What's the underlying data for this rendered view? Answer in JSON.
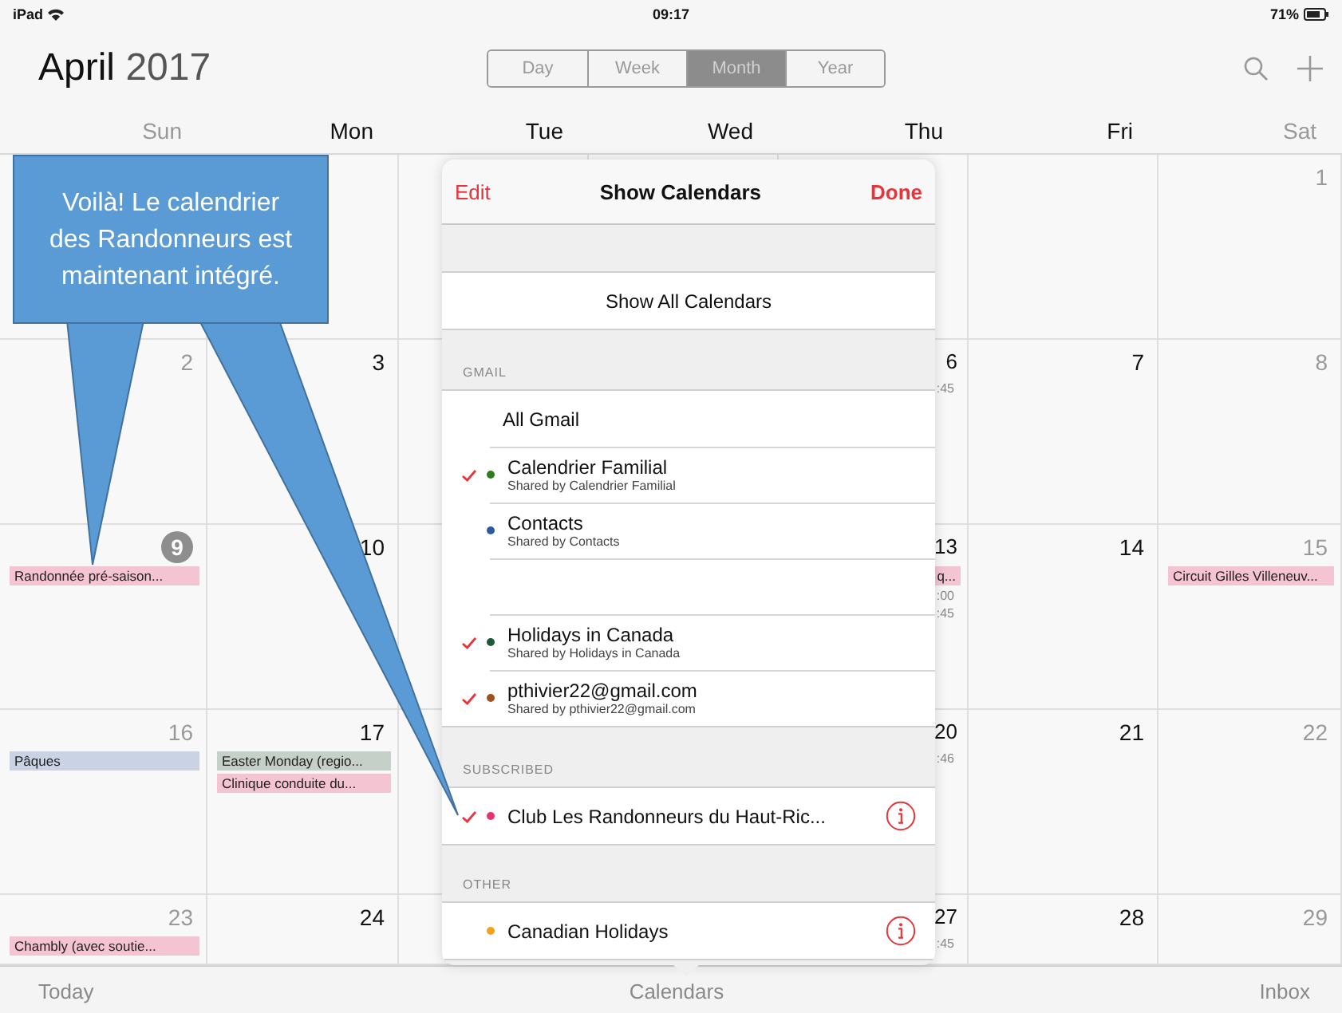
{
  "status_bar": {
    "device": "iPad",
    "time": "09:17",
    "battery": "71%"
  },
  "header": {
    "month": "April",
    "year": "2017",
    "views": [
      {
        "label": "Day",
        "selected": false
      },
      {
        "label": "Week",
        "selected": false
      },
      {
        "label": "Month",
        "selected": true
      },
      {
        "label": "Year",
        "selected": false
      }
    ]
  },
  "weekdays": [
    {
      "label": "Sun",
      "weekend": true
    },
    {
      "label": "Mon",
      "weekend": false
    },
    {
      "label": "Tue",
      "weekend": false
    },
    {
      "label": "Wed",
      "weekend": false
    },
    {
      "label": "Thu",
      "weekend": false
    },
    {
      "label": "Fri",
      "weekend": false
    },
    {
      "label": "Sat",
      "weekend": true
    }
  ],
  "weeks": [
    {
      "days": [
        {
          "kind": "empty"
        },
        {
          "kind": "empty"
        },
        {
          "kind": "empty"
        },
        {
          "kind": "empty"
        },
        {
          "kind": "empty"
        },
        {
          "kind": "empty"
        },
        {
          "kind": "day",
          "date": "1",
          "weekend": true,
          "today": false
        }
      ]
    },
    {
      "days": [
        {
          "kind": "day",
          "date": "2",
          "weekend": true,
          "today": false
        },
        {
          "kind": "day",
          "date": "3",
          "weekend": false,
          "today": false
        },
        {
          "kind": "empty"
        },
        {
          "kind": "empty"
        },
        {
          "kind": "edge",
          "date": "6",
          "weekend": false,
          "today": false,
          "notes": [
            ":45"
          ]
        },
        {
          "kind": "day",
          "date": "7",
          "weekend": false,
          "today": false
        },
        {
          "kind": "day",
          "date": "8",
          "weekend": true,
          "today": false
        }
      ]
    },
    {
      "days": [
        {
          "kind": "day",
          "date": "9",
          "weekend": true,
          "today": true,
          "events": [
            {
              "title": "Randonnée pré-saison...",
              "color": "#f5c4d3"
            }
          ]
        },
        {
          "kind": "day",
          "date": "10",
          "weekend": false,
          "today": false
        },
        {
          "kind": "empty"
        },
        {
          "kind": "empty"
        },
        {
          "kind": "edge",
          "date": "13",
          "weekend": false,
          "today": false,
          "events": [
            {
              "title": "q...",
              "color": "#f5c4d3"
            }
          ],
          "notes": [
            ":00",
            ":45"
          ]
        },
        {
          "kind": "day",
          "date": "14",
          "weekend": false,
          "today": false
        },
        {
          "kind": "day",
          "date": "15",
          "weekend": true,
          "today": false,
          "events": [
            {
              "title": "Circuit Gilles Villeneuv...",
              "color": "#f5c4d3"
            }
          ]
        }
      ]
    },
    {
      "days": [
        {
          "kind": "day",
          "date": "16",
          "weekend": true,
          "today": false,
          "events": [
            {
              "title": "Pâques",
              "color": "#c9d3e4"
            }
          ]
        },
        {
          "kind": "day",
          "date": "17",
          "weekend": false,
          "today": false,
          "events": [
            {
              "title": "Easter Monday (regio...",
              "color": "#c5d0c8"
            },
            {
              "title": "Clinique conduite du...",
              "color": "#f5c4d3"
            }
          ]
        },
        {
          "kind": "empty"
        },
        {
          "kind": "empty"
        },
        {
          "kind": "edge",
          "date": "20",
          "weekend": false,
          "today": false,
          "notes": [
            ":46"
          ]
        },
        {
          "kind": "day",
          "date": "21",
          "weekend": false,
          "today": false
        },
        {
          "kind": "day",
          "date": "22",
          "weekend": true,
          "today": false
        }
      ]
    },
    {
      "days": [
        {
          "kind": "day",
          "date": "23",
          "weekend": true,
          "today": false,
          "events": [
            {
              "title": "Chambly (avec soutie...",
              "color": "#f5c4d3"
            }
          ]
        },
        {
          "kind": "day",
          "date": "24",
          "weekend": false,
          "today": false
        },
        {
          "kind": "empty"
        },
        {
          "kind": "empty"
        },
        {
          "kind": "edge",
          "date": "27",
          "weekend": false,
          "today": false,
          "notes": [
            ":45"
          ]
        },
        {
          "kind": "day",
          "date": "28",
          "weekend": false,
          "today": false
        },
        {
          "kind": "day",
          "date": "29",
          "weekend": true,
          "today": false
        }
      ]
    }
  ],
  "popover": {
    "edit": "Edit",
    "title": "Show Calendars",
    "done": "Done",
    "sections": [
      {
        "rows": [
          {
            "kind": "action",
            "label": "Show All Calendars"
          }
        ]
      },
      {
        "header": "GMAIL",
        "rows": [
          {
            "kind": "plain",
            "label": "All Gmail"
          },
          {
            "kind": "calendar",
            "label": "Calendrier Familial",
            "subtitle": "Shared by Calendrier Familial",
            "checked": true,
            "color": "#2e7d1e",
            "info": false
          },
          {
            "kind": "calendar",
            "label": "Contacts",
            "subtitle": "Shared by Contacts",
            "checked": false,
            "color": "#2a5b9c",
            "info": false
          },
          {
            "kind": "blank"
          },
          {
            "kind": "calendar",
            "label": "Holidays in Canada",
            "subtitle": "Shared by Holidays in Canada",
            "checked": true,
            "color": "#1e5a38",
            "info": false
          },
          {
            "kind": "calendar",
            "label": "pthivier22@gmail.com",
            "subtitle": "Shared by pthivier22@gmail.com",
            "checked": true,
            "color": "#a0521e",
            "info": false
          }
        ]
      },
      {
        "header": "SUBSCRIBED",
        "rows": [
          {
            "kind": "calendar",
            "label": "Club Les Randonneurs du Haut-Ric...",
            "checked": true,
            "color": "#e8336b",
            "info": true
          }
        ]
      },
      {
        "header": "OTHER",
        "rows": [
          {
            "kind": "calendar",
            "label": "Canadian Holidays",
            "checked": false,
            "color": "#f4a020",
            "info": true
          }
        ]
      }
    ]
  },
  "callout": {
    "text": "Voilà! Le calendrier des Randonneurs est maintenant intégré."
  },
  "tab_bar": [
    "Today",
    "Calendars",
    "Inbox"
  ]
}
